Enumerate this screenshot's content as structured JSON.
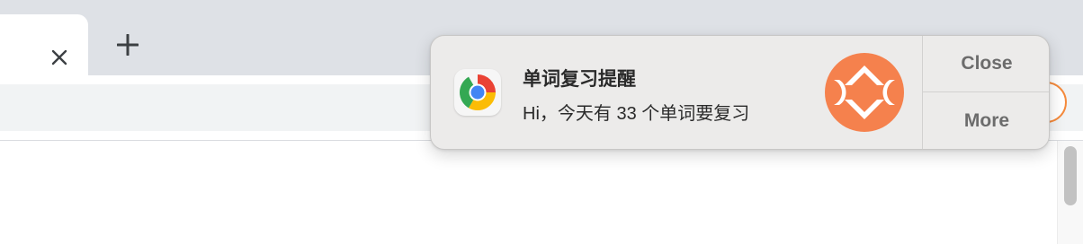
{
  "browser": {
    "tab": {
      "close_icon": "close-icon"
    },
    "new_tab_icon": "plus-icon"
  },
  "notification": {
    "app_icon": "chrome-icon",
    "title": "单词复习提醒",
    "message": "Hi，今天有 33 个单词要复习",
    "content_image": "app-logo-icon",
    "actions": {
      "close_label": "Close",
      "more_label": "More"
    }
  },
  "colors": {
    "accent": "#f5814d",
    "tabstrip": "#dee1e6",
    "notification_bg": "#ecebea"
  }
}
